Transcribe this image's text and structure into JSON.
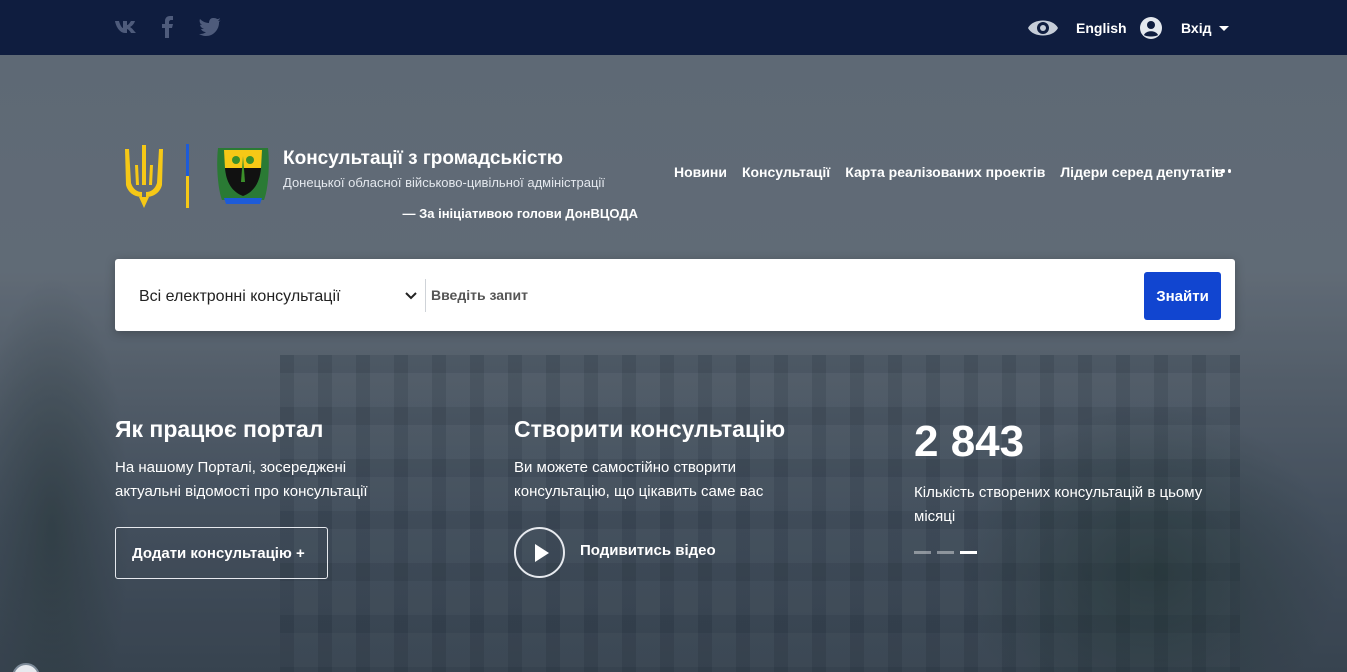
{
  "topbar": {
    "social": [
      "vk-icon",
      "facebook-icon",
      "twitter-icon"
    ],
    "language_label": "English",
    "login_label": "Вхід"
  },
  "brand": {
    "title": "Консультації з громадськістю",
    "subtitle": "Донецької обласної військово-цивільної адміністрації",
    "note": "— За ініціативою голови ДонВЦОДА"
  },
  "nav": {
    "items": [
      "Новини",
      "Консультації",
      "Карта реалізованих проектів",
      "Лідери серед депутатів"
    ]
  },
  "search": {
    "category": "Всі електронні консультації",
    "placeholder": "Введіть запит",
    "button_label": "Знайти"
  },
  "how_it_works": {
    "title": "Як працює портал",
    "text": "На нашому Порталі, зосереджені актуальні відомості про консультації",
    "button_label": "Додати консультацію  +"
  },
  "create": {
    "title": "Створити консультацію",
    "text": "Ви можете самостійно створити консультацію, що цікавить саме вас",
    "video_label": "Подивитись відео"
  },
  "stats": {
    "value": "2 843",
    "caption": "Кількість створених консультацій в цьому місяці",
    "slides": 3,
    "active_slide": 3
  },
  "colors": {
    "topbar_bg": "#0f1d3f",
    "accent": "#1145d0",
    "flag_blue": "#1d5bd8",
    "flag_yellow": "#f6c816"
  }
}
